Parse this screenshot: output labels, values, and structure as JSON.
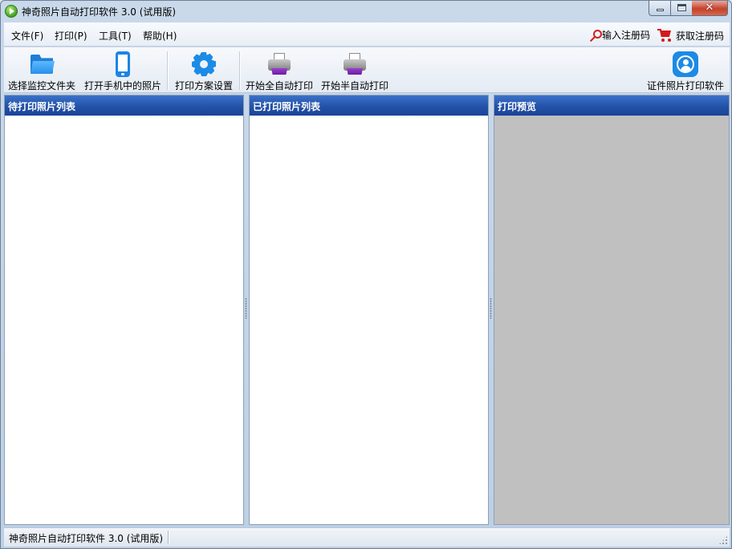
{
  "window": {
    "title": "神奇照片自动打印软件 3.0 (试用版)",
    "close_glyph": "✕"
  },
  "menu": [
    {
      "label": "文件(F)"
    },
    {
      "label": "打印(P)"
    },
    {
      "label": "工具(T)"
    },
    {
      "label": "帮助(H)"
    }
  ],
  "registration": {
    "enter_code": "输入注册码",
    "get_code": "获取注册码"
  },
  "toolbar": {
    "select_folder": "选择监控文件夹",
    "phone_photos": "打开手机中的照片",
    "print_settings": "打印方案设置",
    "full_auto_print": "开始全自动打印",
    "semi_auto_print": "开始半自动打印",
    "id_photo_software": "证件照片打印软件"
  },
  "panels": {
    "pending": "待打印照片列表",
    "printed": "已打印照片列表",
    "preview": "打印预览"
  },
  "status": {
    "text": "神奇照片自动打印软件 3.0 (试用版)"
  },
  "icons": {
    "app": "app-play-icon",
    "folder": "folder-icon",
    "phone": "phone-icon",
    "gear": "gear-icon",
    "printer": "printer-icon",
    "person": "person-icon",
    "key": "key-icon",
    "cart": "cart-icon"
  },
  "colors": {
    "panel_header": "#2352a8",
    "preview_bg": "#c0c0c0",
    "accent_icon": "#1d8ae5",
    "registration_icon": "#d31f1f"
  }
}
